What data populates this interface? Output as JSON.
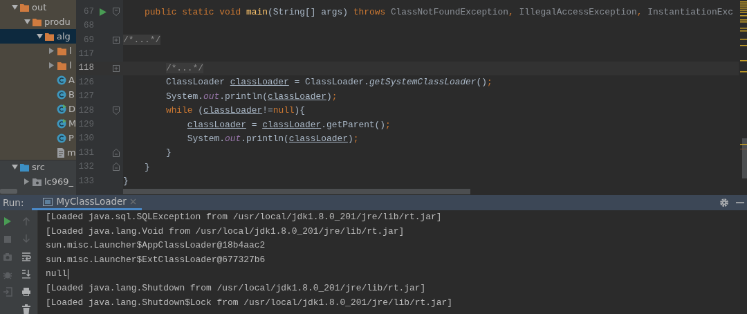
{
  "project_tree": [
    {
      "label": "out",
      "kind": "output-folder",
      "expanded": true,
      "selected": false,
      "children": [
        {
          "label": "produ",
          "kind": "output-folder",
          "expanded": true,
          "selected": false,
          "children": [
            {
              "label": "alg",
              "kind": "output-folder",
              "expanded": true,
              "selected": true,
              "children": [
                {
                  "label": "l",
                  "kind": "output-folder",
                  "expanded": false,
                  "selected": false
                },
                {
                  "label": "l",
                  "kind": "output-folder",
                  "expanded": false,
                  "selected": false
                },
                {
                  "label": "A",
                  "kind": "class",
                  "runnable": false,
                  "selected": false
                },
                {
                  "label": "B",
                  "kind": "class",
                  "runnable": false,
                  "selected": false
                },
                {
                  "label": "D",
                  "kind": "class",
                  "runnable": true,
                  "selected": false
                },
                {
                  "label": "M",
                  "kind": "class",
                  "runnable": true,
                  "selected": false
                },
                {
                  "label": "P",
                  "kind": "class",
                  "runnable": false,
                  "selected": false
                },
                {
                  "label": "m",
                  "kind": "file",
                  "selected": false
                }
              ]
            }
          ]
        }
      ]
    },
    {
      "label": "src",
      "kind": "source-folder",
      "expanded": true,
      "selected": false,
      "children": [
        {
          "label": "lc969_",
          "kind": "package",
          "expanded": false,
          "selected": false
        }
      ]
    }
  ],
  "editor": {
    "lines": [
      {
        "number": "67",
        "current": false,
        "gutter_icons": [
          {
            "kind": "run"
          },
          {
            "kind": "fold-start"
          }
        ],
        "tokens": [
          {
            "text": "    public",
            "kind": "kw"
          },
          {
            "text": " static void",
            "kind": "kw"
          },
          {
            "text": " main",
            "kind": "method"
          },
          {
            "text": "(String[] args) ",
            "kind": "plain"
          },
          {
            "text": "throws",
            "kind": "kw"
          },
          {
            "text": " ClassNotFoundException",
            "kind": "dim"
          },
          {
            "text": ",",
            "kind": "punct"
          },
          {
            "text": " IllegalAccessException",
            "kind": "dim"
          },
          {
            "text": ",",
            "kind": "punct"
          },
          {
            "text": " InstantiationExc",
            "kind": "dim"
          }
        ]
      },
      {
        "number": "68",
        "current": false
      },
      {
        "number": "69",
        "current": false,
        "gutter_icons": [
          {
            "kind": "fold-collapsed"
          }
        ],
        "tokens": [
          {
            "text": "/*...*/",
            "kind": "folded"
          }
        ]
      },
      {
        "number": "117",
        "current": false
      },
      {
        "number": "118",
        "current": true,
        "gutter_icons": [
          {
            "kind": "fold-collapsed"
          }
        ],
        "tokens": [
          {
            "text": "        /*...*/",
            "kind": "folded"
          }
        ]
      },
      {
        "number": "126",
        "current": false,
        "tokens": [
          {
            "text": "        ClassLoader ",
            "kind": "plain"
          },
          {
            "text": "classLoader",
            "kind": "var"
          },
          {
            "text": " = ClassLoader.",
            "kind": "plain"
          },
          {
            "text": "getSystemClassLoader",
            "kind": "static"
          },
          {
            "text": "()",
            "kind": "plain"
          },
          {
            "text": ";",
            "kind": "punct"
          }
        ]
      },
      {
        "number": "127",
        "current": false,
        "tokens": [
          {
            "text": "        System.",
            "kind": "plain"
          },
          {
            "text": "out",
            "kind": "field"
          },
          {
            "text": ".println(",
            "kind": "plain"
          },
          {
            "text": "classLoader",
            "kind": "var"
          },
          {
            "text": ")",
            "kind": "plain"
          },
          {
            "text": ";",
            "kind": "punct"
          }
        ]
      },
      {
        "number": "128",
        "current": false,
        "gutter_icons": [
          {
            "kind": "fold-start"
          }
        ],
        "tokens": [
          {
            "text": "        while",
            "kind": "kw"
          },
          {
            "text": " (",
            "kind": "plain"
          },
          {
            "text": "classLoader",
            "kind": "var"
          },
          {
            "text": "!=",
            "kind": "plain"
          },
          {
            "text": "null",
            "kind": "kw"
          },
          {
            "text": "){",
            "kind": "plain"
          }
        ]
      },
      {
        "number": "129",
        "current": false,
        "tokens": [
          {
            "text": "            classLoader",
            "kind": "var"
          },
          {
            "text": " = ",
            "kind": "plain"
          },
          {
            "text": "classLoader",
            "kind": "var"
          },
          {
            "text": ".getParent()",
            "kind": "plain"
          },
          {
            "text": ";",
            "kind": "punct"
          }
        ]
      },
      {
        "number": "130",
        "current": false,
        "tokens": [
          {
            "text": "            System.",
            "kind": "plain"
          },
          {
            "text": "out",
            "kind": "field"
          },
          {
            "text": ".println(",
            "kind": "plain"
          },
          {
            "text": "classLoader",
            "kind": "var"
          },
          {
            "text": ")",
            "kind": "plain"
          },
          {
            "text": ";",
            "kind": "punct"
          }
        ]
      },
      {
        "number": "131",
        "current": false,
        "gutter_icons": [
          {
            "kind": "fold-end"
          }
        ],
        "tokens": [
          {
            "text": "        }",
            "kind": "plain"
          }
        ]
      },
      {
        "number": "132",
        "current": false,
        "gutter_icons": [
          {
            "kind": "fold-end"
          }
        ],
        "tokens": [
          {
            "text": "    }",
            "kind": "plain"
          }
        ]
      },
      {
        "number": "133",
        "current": false,
        "tokens": [
          {
            "text": "}",
            "kind": "plain"
          }
        ]
      }
    ]
  },
  "run_panel": {
    "label": "Run:",
    "tabs": [
      {
        "label": "MyClassLoader",
        "selected": true,
        "closable": true
      }
    ],
    "header_actions": [
      {
        "kind": "settings"
      },
      {
        "kind": "minimize"
      }
    ],
    "toolbar_primary": [
      {
        "kind": "run",
        "disabled": false
      },
      {
        "kind": "stop",
        "disabled": true
      },
      {
        "kind": "camera",
        "disabled": true
      },
      {
        "kind": "bug",
        "disabled": true
      },
      {
        "kind": "exit",
        "disabled": true
      }
    ],
    "toolbar_secondary": [
      {
        "kind": "up",
        "disabled": true
      },
      {
        "kind": "down",
        "disabled": true
      },
      {
        "kind": "wrap",
        "disabled": false
      },
      {
        "kind": "scroll-end",
        "disabled": false
      },
      {
        "kind": "print",
        "disabled": false
      },
      {
        "kind": "trash",
        "disabled": false
      }
    ],
    "console": [
      {
        "text": "[Loaded java.sql.SQLException from /usr/local/jdk1.8.0_201/jre/lib/rt.jar]",
        "cursor": false
      },
      {
        "text": "[Loaded java.lang.Void from /usr/local/jdk1.8.0_201/jre/lib/rt.jar]",
        "cursor": false
      },
      {
        "text": "sun.misc.Launcher$AppClassLoader@18b4aac2",
        "cursor": false
      },
      {
        "text": "sun.misc.Launcher$ExtClassLoader@677327b6",
        "cursor": false
      },
      {
        "text": "null",
        "cursor": true
      },
      {
        "text": "[Loaded java.lang.Shutdown from /usr/local/jdk1.8.0_201/jre/lib/rt.jar]",
        "cursor": false
      },
      {
        "text": "[Loaded java.lang.Shutdown$Lock from /usr/local/jdk1.8.0_201/jre/lib/rt.jar]",
        "cursor": false
      }
    ]
  }
}
